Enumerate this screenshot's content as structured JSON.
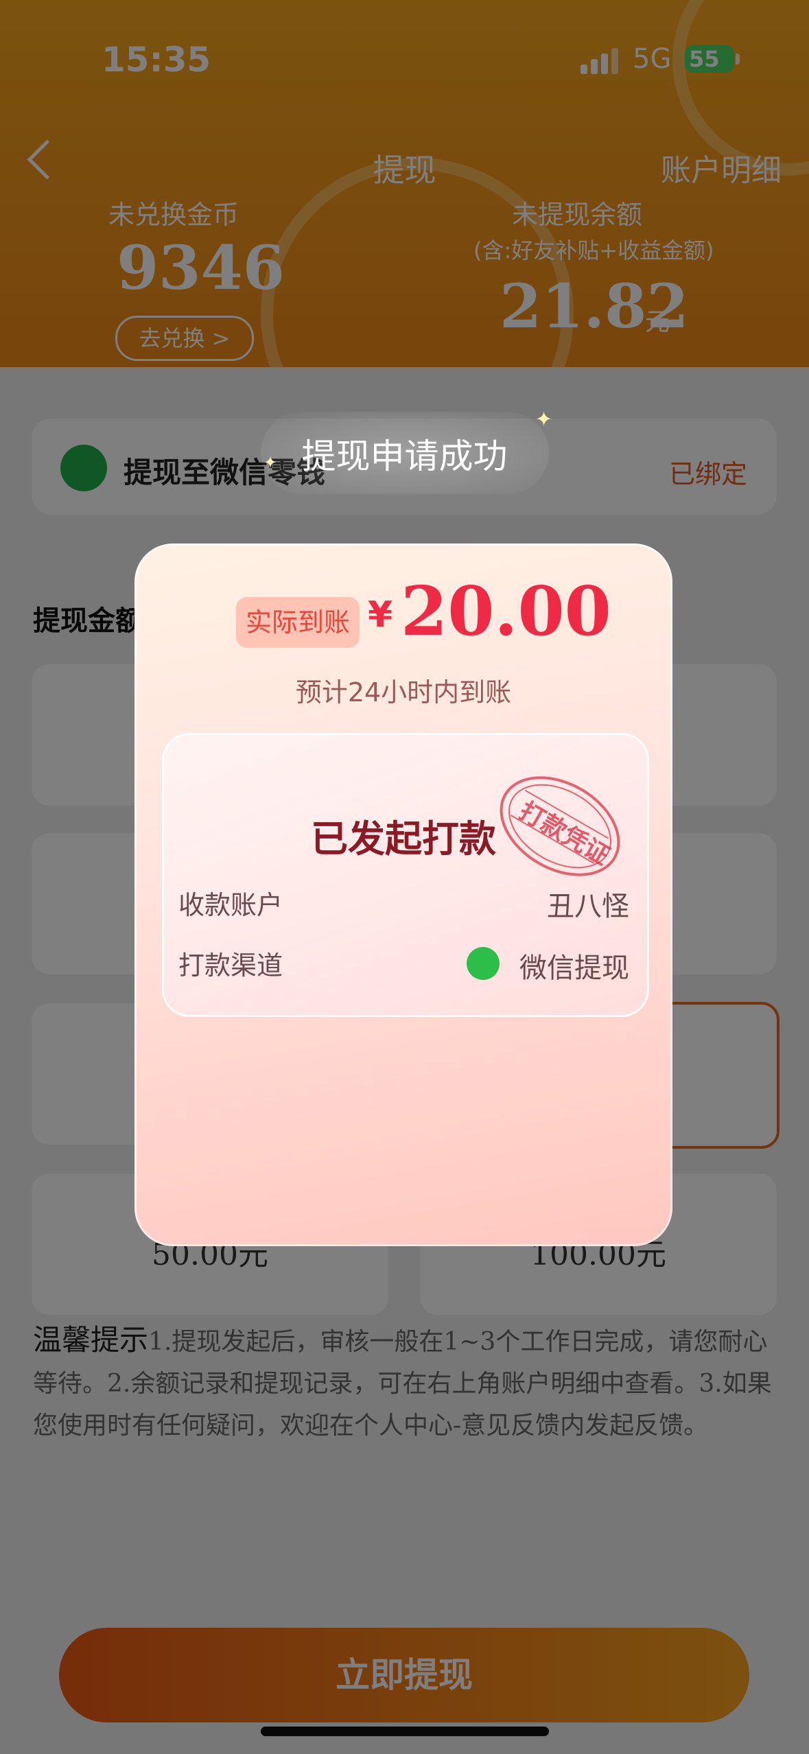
{
  "status_bar": {
    "time": "15:35",
    "network": "5G",
    "battery": "55"
  },
  "nav": {
    "title": "提现",
    "right_link": "账户明细"
  },
  "header": {
    "coins_label": "未兑换金币",
    "coins_value": "9346",
    "exchange_button": "去兑换 >",
    "balance_label": "未提现余额",
    "balance_note": "(含:好友补贴+收益金额)",
    "balance_value": "21.82",
    "balance_unit": "元"
  },
  "wechat_card": {
    "label": "提现至微信零钱",
    "status": "已绑定"
  },
  "amount_section": {
    "title": "提现金额",
    "options": [
      "",
      "",
      "",
      "",
      "",
      "",
      "50.00元",
      "100.00元"
    ]
  },
  "tips": {
    "title": "温馨提示",
    "text": "1.提现发起后，审核一般在1~3个工作日完成，请您耐心等待。2.余额记录和提现记录，可在右上角账户明细中查看。3.如果您使用时有任何疑问，欢迎在个人中心-意见反馈内发起反馈。"
  },
  "submit_button": "立即提现",
  "toast": "提现申请成功",
  "modal": {
    "actual_label": "实际到账",
    "currency": "¥",
    "amount": "20.00",
    "eta": "预计24小时内到账",
    "status": "已发起打款",
    "stamp_text": "打款凭证",
    "account_label": "收款账户",
    "account_value": "丑八怪",
    "channel_label": "打款渠道",
    "channel_value": "微信提现"
  },
  "colors": {
    "brand_orange": "#f39a1c",
    "accent_red": "#ee2a44",
    "wechat_green": "#1fb04a"
  }
}
